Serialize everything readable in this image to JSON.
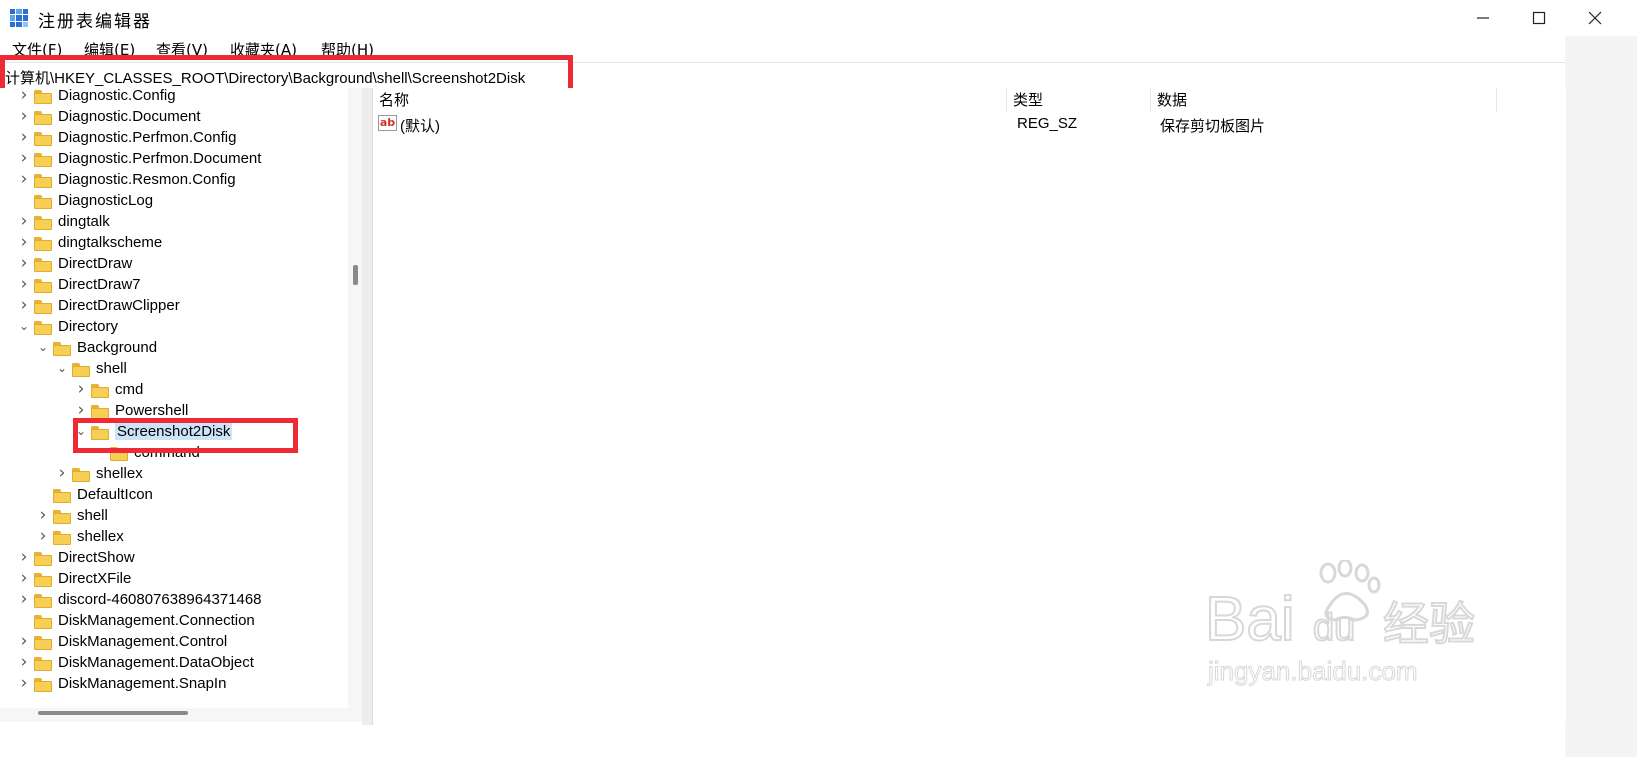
{
  "window": {
    "title": "注册表编辑器"
  },
  "menu": [
    "文件(F)",
    "编辑(E)",
    "查看(V)",
    "收藏夹(A)",
    "帮助(H)"
  ],
  "address": "计算机\\HKEY_CLASSES_ROOT\\Directory\\Background\\shell\\Screenshot2Disk",
  "tree": [
    {
      "label": "Diagnostic.Config",
      "level": 1,
      "caret": "right"
    },
    {
      "label": "Diagnostic.Document",
      "level": 1,
      "caret": "right"
    },
    {
      "label": "Diagnostic.Perfmon.Config",
      "level": 1,
      "caret": "right"
    },
    {
      "label": "Diagnostic.Perfmon.Document",
      "level": 1,
      "caret": "right"
    },
    {
      "label": "Diagnostic.Resmon.Config",
      "level": 1,
      "caret": "right"
    },
    {
      "label": "DiagnosticLog",
      "level": 1,
      "caret": "none"
    },
    {
      "label": "dingtalk",
      "level": 1,
      "caret": "right"
    },
    {
      "label": "dingtalkscheme",
      "level": 1,
      "caret": "right"
    },
    {
      "label": "DirectDraw",
      "level": 1,
      "caret": "right"
    },
    {
      "label": "DirectDraw7",
      "level": 1,
      "caret": "right"
    },
    {
      "label": "DirectDrawClipper",
      "level": 1,
      "caret": "right"
    },
    {
      "label": "Directory",
      "level": 1,
      "caret": "down"
    },
    {
      "label": "Background",
      "level": 2,
      "caret": "down"
    },
    {
      "label": "shell",
      "level": 3,
      "caret": "down"
    },
    {
      "label": "cmd",
      "level": 4,
      "caret": "right"
    },
    {
      "label": "Powershell",
      "level": 4,
      "caret": "right"
    },
    {
      "label": "Screenshot2Disk",
      "level": 4,
      "caret": "down",
      "selected": true
    },
    {
      "label": "command",
      "level": 5,
      "caret": "none"
    },
    {
      "label": "shellex",
      "level": 3,
      "caret": "right"
    },
    {
      "label": "DefaultIcon",
      "level": 2,
      "caret": "none"
    },
    {
      "label": "shell",
      "level": 2,
      "caret": "right"
    },
    {
      "label": "shellex",
      "level": 2,
      "caret": "right"
    },
    {
      "label": "DirectShow",
      "level": 1,
      "caret": "right"
    },
    {
      "label": "DirectXFile",
      "level": 1,
      "caret": "right"
    },
    {
      "label": "discord-460807638964371468",
      "level": 1,
      "caret": "right"
    },
    {
      "label": "DiskManagement.Connection",
      "level": 1,
      "caret": "none"
    },
    {
      "label": "DiskManagement.Control",
      "level": 1,
      "caret": "right"
    },
    {
      "label": "DiskManagement.DataObject",
      "level": 1,
      "caret": "right"
    },
    {
      "label": "DiskManagement.SnapIn",
      "level": 1,
      "caret": "right"
    }
  ],
  "columns": [
    "名称",
    "类型",
    "数据"
  ],
  "values": [
    {
      "name": "(默认)",
      "type": "REG_SZ",
      "data": "保存剪切板图片"
    }
  ],
  "watermark": {
    "main": "Bai",
    "du": "du",
    "cn": "经验",
    "url": "jingyan.baidu.com"
  },
  "colors": {
    "highlight": "#ee2a35",
    "selected": "#cce4f7",
    "folder": "#f8cf55"
  }
}
